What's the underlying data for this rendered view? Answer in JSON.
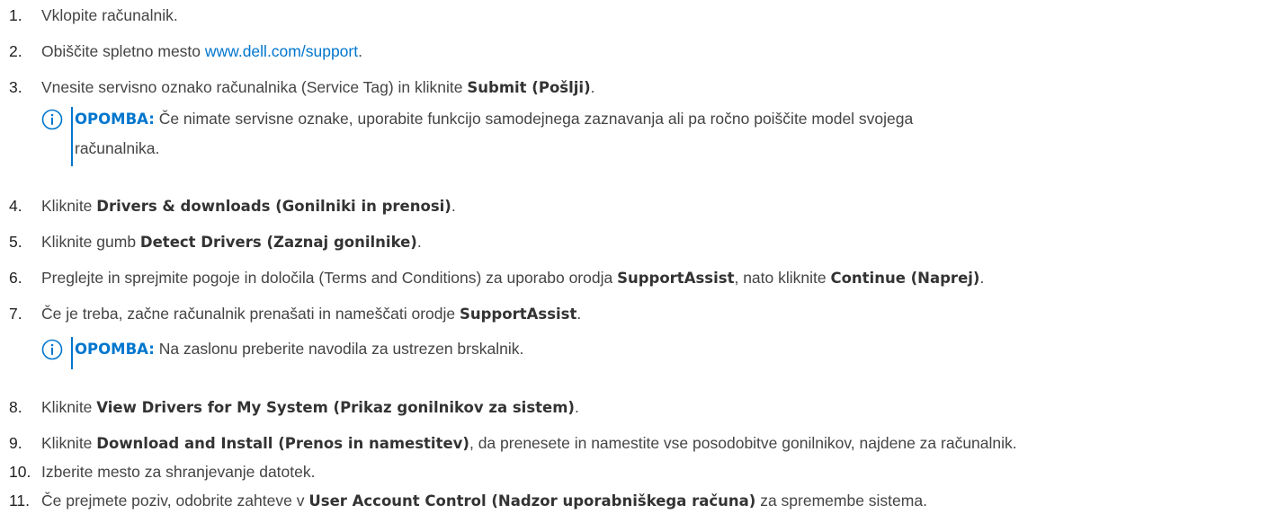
{
  "steps": [
    {
      "num": "1.",
      "parts": [
        {
          "t": "Vklopite računalnik."
        }
      ]
    },
    {
      "num": "2.",
      "parts": [
        {
          "t": "Obiščite spletno mesto "
        },
        {
          "t": "www.dell.com/support",
          "link": true
        },
        {
          "t": "."
        }
      ]
    },
    {
      "num": "3.",
      "parts": [
        {
          "t": "Vnesite servisno oznako računalnika (Service Tag) in kliknite "
        },
        {
          "t": "Submit (Pošlji)",
          "b": true
        },
        {
          "t": "."
        }
      ]
    },
    {
      "num": "4.",
      "parts": [
        {
          "t": "Kliknite "
        },
        {
          "t": "Drivers & downloads (Gonilniki in prenosi)",
          "b": true
        },
        {
          "t": "."
        }
      ]
    },
    {
      "num": "5.",
      "parts": [
        {
          "t": "Kliknite gumb "
        },
        {
          "t": "Detect Drivers (Zaznaj gonilnike)",
          "b": true
        },
        {
          "t": "."
        }
      ]
    },
    {
      "num": "6.",
      "parts": [
        {
          "t": "Preglejte in sprejmite pogoje in določila (Terms and Conditions) za uporabo orodja "
        },
        {
          "t": "SupportAssist",
          "b": true
        },
        {
          "t": ", nato kliknite "
        },
        {
          "t": "Continue (Naprej)",
          "b": true
        },
        {
          "t": "."
        }
      ]
    },
    {
      "num": "7.",
      "parts": [
        {
          "t": "Če je treba, začne računalnik prenašati in nameščati orodje "
        },
        {
          "t": "SupportAssist",
          "b": true
        },
        {
          "t": "."
        }
      ]
    },
    {
      "num": "8.",
      "parts": [
        {
          "t": "Kliknite "
        },
        {
          "t": "View Drivers for My System (Prikaz gonilnikov za sistem)",
          "b": true
        },
        {
          "t": "."
        }
      ]
    },
    {
      "num": "9.",
      "parts": [
        {
          "t": "Kliknite "
        },
        {
          "t": "Download and Install (Prenos in namestitev)",
          "b": true
        },
        {
          "t": ", da prenesete in namestite vse posodobitve gonilnikov, najdene za računalnik."
        }
      ]
    },
    {
      "num": "10.",
      "parts": [
        {
          "t": "Izberite mesto za shranjevanje datotek."
        }
      ]
    },
    {
      "num": "11.",
      "parts": [
        {
          "t": "Če prejmete poziv, odobrite zahteve v "
        },
        {
          "t": "User Account Control (Nadzor uporabniškega računa)",
          "b": true
        },
        {
          "t": " za spremembe sistema."
        }
      ]
    }
  ],
  "notes": [
    {
      "label": "OPOMBA:",
      "lines": [
        "Če nimate servisne oznake, uporabite funkcijo samodejnega zaznavanja ali pa ročno poiščite model svojega",
        "računalnika."
      ]
    },
    {
      "label": "OPOMBA:",
      "lines": [
        "Na zaslonu preberite navodila za ustrezen brskalnik."
      ]
    }
  ],
  "colors": {
    "accent": "#0076CE",
    "text": "#444444"
  },
  "icons": {
    "note": "info-circle-icon"
  }
}
